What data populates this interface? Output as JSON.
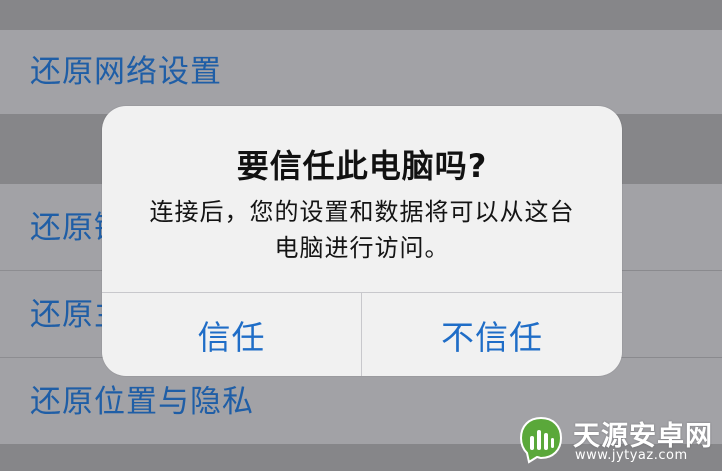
{
  "settings_rows": [
    {
      "label": "还原网络设置"
    },
    {
      "label": "还原键"
    },
    {
      "label": "还原主"
    },
    {
      "label": "还原位置与隐私"
    }
  ],
  "alert": {
    "title": "要信任此电脑吗?",
    "message_line1": "连接后，您的设置和数据将可以从这台",
    "message_line2": "电脑进行访问。",
    "trust_button": "信任",
    "dont_trust_button": "不信任"
  },
  "watermark": {
    "name": "天源安卓网",
    "url": "www.jytyaz.com"
  },
  "colors": {
    "link_blue": "#1f6dc7",
    "row_text": "#1f5ea6",
    "alert_bg": "#f1f1f1"
  }
}
